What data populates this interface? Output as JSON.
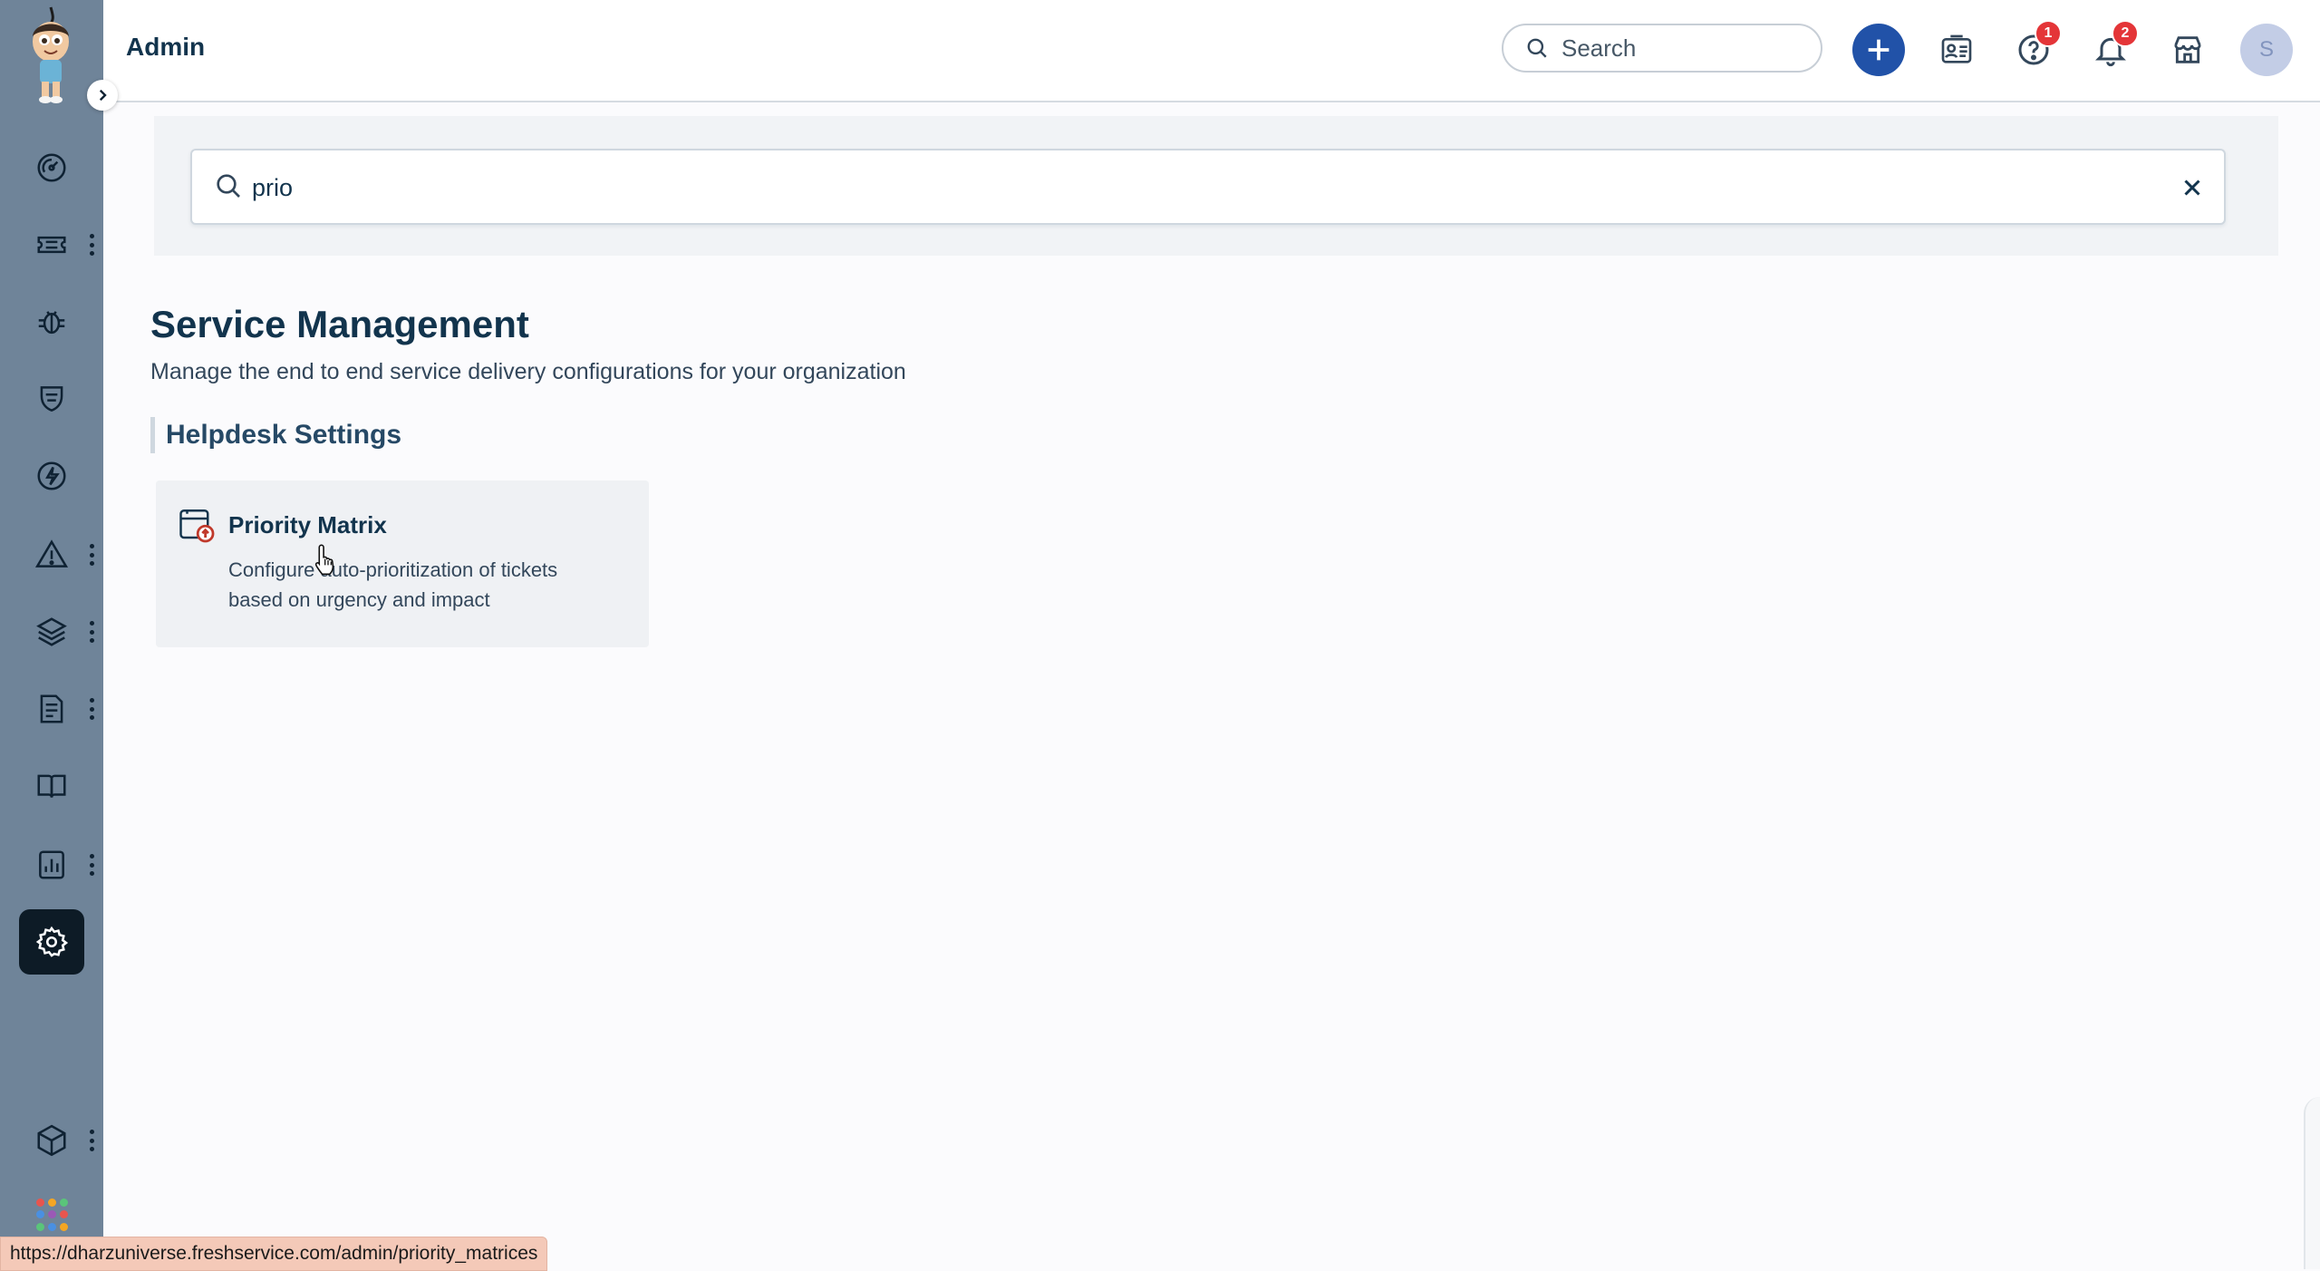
{
  "header": {
    "title": "Admin",
    "search_label": "Search",
    "help_badge": "1",
    "notifications_badge": "2",
    "avatar_initial": "S"
  },
  "admin_search": {
    "value": "prio"
  },
  "section": {
    "title": "Service Management",
    "description": "Manage the end to end service delivery configurations for your organization",
    "group_title": "Helpdesk Settings"
  },
  "card": {
    "title": "Priority Matrix",
    "description": "Configure auto-prioritization of tickets based on urgency and impact",
    "icon": "priority-matrix-icon"
  },
  "sidebar": {
    "items": [
      {
        "icon": "dashboard-icon"
      },
      {
        "icon": "tickets-icon"
      },
      {
        "icon": "problems-bug-icon"
      },
      {
        "icon": "changes-shield-icon"
      },
      {
        "icon": "releases-bolt-icon"
      },
      {
        "icon": "alerts-icon"
      },
      {
        "icon": "assets-layers-icon"
      },
      {
        "icon": "contracts-document-icon"
      },
      {
        "icon": "solutions-book-icon"
      },
      {
        "icon": "analytics-icon"
      },
      {
        "icon": "admin-gear-icon",
        "active": true
      },
      {
        "icon": "apps-cube-icon"
      }
    ]
  },
  "status_bar": {
    "url": "https://dharzuniverse.freshservice.com/admin/priority_matrices"
  },
  "colors": {
    "sidebar_bg": "#6f8499",
    "active_nav_bg": "#0d1b26",
    "primary_button": "#2152a8",
    "badge": "#e43538",
    "status_bar_bg": "#f4c9b8"
  }
}
